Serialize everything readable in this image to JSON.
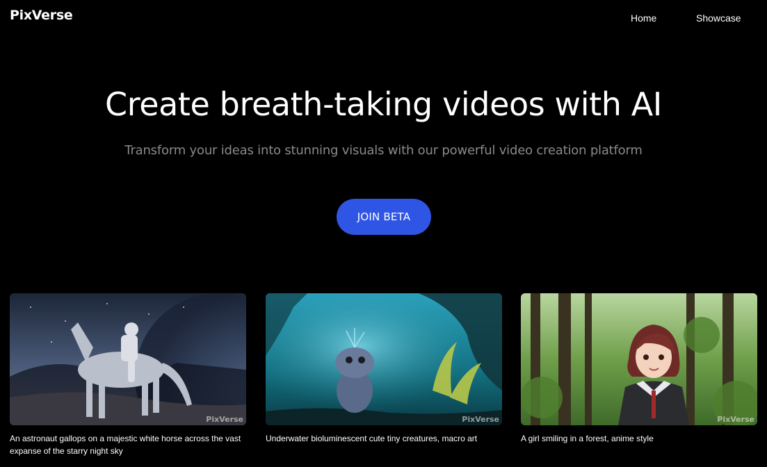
{
  "header": {
    "logo": "PixVerse",
    "nav": [
      {
        "label": "Home"
      },
      {
        "label": "Showcase"
      }
    ]
  },
  "hero": {
    "title": "Create breath-taking videos with AI",
    "subtitle": "Transform your ideas into stunning visuals with our powerful video creation platform",
    "cta_label": "JOIN BETA"
  },
  "showcase": {
    "cards": [
      {
        "image": "astronaut-on-horse-night-sky",
        "watermark": "PixVerse",
        "caption": "An astronaut gallops on a majestic white horse across the vast expanse of the starry night sky"
      },
      {
        "image": "underwater-creature",
        "watermark": "PixVerse",
        "caption": "Underwater bioluminescent cute tiny creatures, macro art"
      },
      {
        "image": "anime-girl-forest",
        "watermark": "PixVerse",
        "caption": "A girl smiling in a forest, anime style"
      }
    ]
  },
  "colors": {
    "background": "#000000",
    "accent": "#2f55e4",
    "subtitle": "#8a8a8a"
  }
}
